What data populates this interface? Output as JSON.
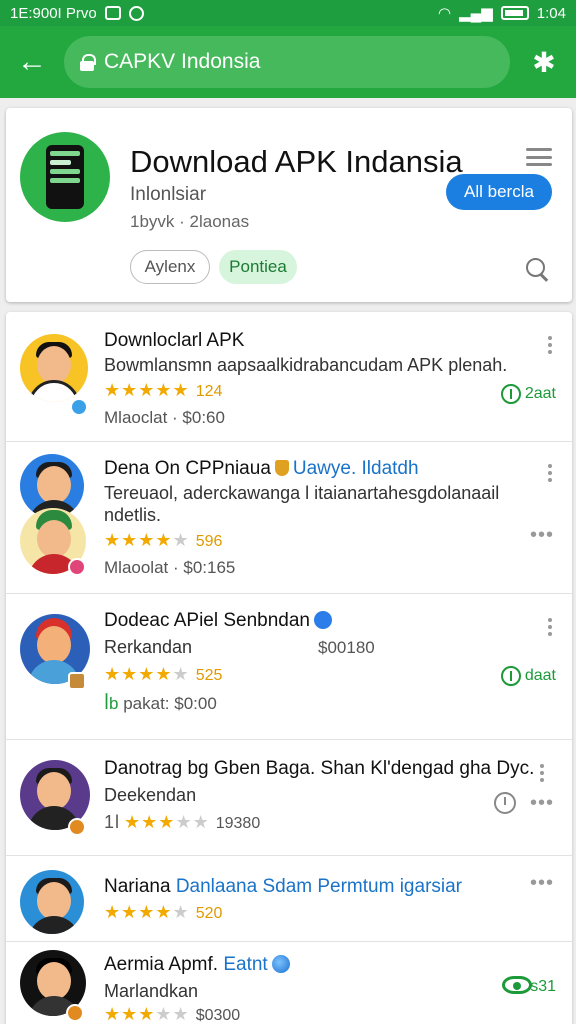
{
  "status_bar": {
    "left_text": "1E:900I Prvo",
    "right_text": "1:04"
  },
  "toolbar": {
    "url": "CAPKV Indonsia"
  },
  "header": {
    "title": "Download APK Indansia",
    "subtitle": "Inlonlsiar",
    "meta": "1byvk · 2laonas",
    "all_button": "All bercla",
    "chip_outline": "Aylenx",
    "chip_green": "Pontiea"
  },
  "items": [
    {
      "title": "Downloclarl APK",
      "desc": "Bowmlansmn aapsaalkidrabancudam APK plenah.",
      "stars": "★★★★★",
      "empty_stars": "",
      "count": "124",
      "meta": "Mlaoclat · $0:60",
      "download": "2aat",
      "accent": "#f7c325"
    },
    {
      "title": "Dena On CPPniaua",
      "link": "Uawye. Ildatdh",
      "desc": "Tereuaol, aderckawanga l itaianartahesgdolanaail ndetlis.",
      "stars": "★★★★",
      "empty_stars": "★",
      "count": "596",
      "meta": "Mlaoolat · $0:165",
      "accent": "#2a7de1"
    },
    {
      "title": "Dodeac APiel Senbndan",
      "desc": "Rerkandan",
      "price": "$00180",
      "stars": "★★★★",
      "empty_stars": "★",
      "count": "525",
      "meta": "pakat: $0:00",
      "meta_prefix": "ꟾb",
      "download": "daat",
      "accent": "#2b5fb8"
    },
    {
      "title": "Danotrag bg Gben Baga. Shan Kl'dengad gha Dyc.",
      "desc": "Deekendan",
      "prefix": "1l",
      "stars": "★★★",
      "empty_stars": "★★",
      "count": "19380",
      "accent": "#5a3a8a"
    },
    {
      "title": "Nariana",
      "link": "Danlaana Sdam Permtum igarsiar",
      "stars": "★★★★",
      "empty_stars": "★",
      "count": "520",
      "accent": "#2a8fd6"
    },
    {
      "title": "Aermia Apmf.",
      "link": "Eatnt",
      "desc": "Marlandkan",
      "stars": "★★★",
      "empty_stars": "★★",
      "count": "$0300",
      "eye_count": "s31",
      "accent": "#111111"
    }
  ],
  "colors": {
    "primary": "#22a83f",
    "accent_blue": "#1a7fe0",
    "star": "#f2a900"
  }
}
